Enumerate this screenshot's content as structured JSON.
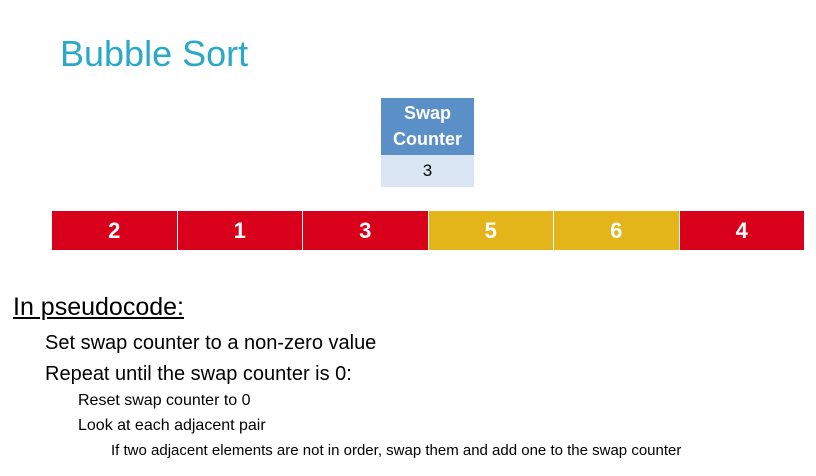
{
  "title": "Bubble Sort",
  "swap_counter": {
    "label_line1": "Swap",
    "label_line2": "Counter",
    "value": "3"
  },
  "array": [
    {
      "value": "2",
      "state": "unsorted",
      "color": "#d9001b"
    },
    {
      "value": "1",
      "state": "unsorted",
      "color": "#d9001b"
    },
    {
      "value": "3",
      "state": "unsorted",
      "color": "#d9001b"
    },
    {
      "value": "5",
      "state": "compared",
      "color": "#e4b51b"
    },
    {
      "value": "6",
      "state": "compared",
      "color": "#e4b51b"
    },
    {
      "value": "4",
      "state": "unsorted",
      "color": "#d9001b"
    }
  ],
  "pseudocode": {
    "heading": "In pseudocode:",
    "lines": [
      "Set swap counter to a non-zero value",
      "Repeat until the swap counter is 0:",
      "Reset swap counter to 0",
      "Look at each adjacent pair",
      "If two adjacent elements are not in order, swap them and add one to the swap counter"
    ]
  },
  "colors": {
    "title": "#2aa8c8",
    "swap_header": "#5b8fc7",
    "swap_value_bg": "#dbe6f4",
    "unsorted": "#d9001b",
    "compared": "#e4b51b"
  }
}
